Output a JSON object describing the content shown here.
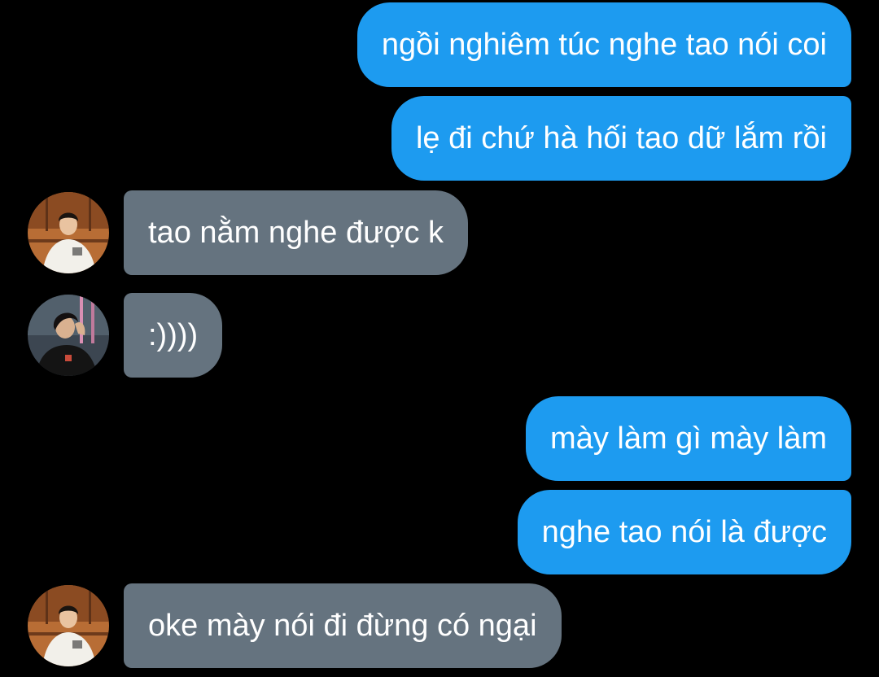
{
  "conversation": {
    "messages": [
      {
        "direction": "out",
        "text": "ngồi nghiêm túc nghe tao nói coi"
      },
      {
        "direction": "out",
        "text": "lẹ đi chứ hà hối tao dữ lắm rồi"
      },
      {
        "direction": "in",
        "avatar": "avatar-person-white-shirt",
        "text": "tao nằm nghe được k"
      },
      {
        "direction": "in",
        "avatar": "avatar-person-black-shirt",
        "text": ":))))"
      },
      {
        "direction": "out",
        "text": "mày làm gì mày làm"
      },
      {
        "direction": "out",
        "text": "nghe tao nói là được"
      },
      {
        "direction": "in",
        "avatar": "avatar-person-white-shirt",
        "text": "oke mày nói đi đừng có ngại"
      }
    ]
  },
  "colors": {
    "background": "#000000",
    "outgoing_bubble": "#1d9bf0",
    "incoming_bubble": "#65737f",
    "text": "#ffffff"
  }
}
